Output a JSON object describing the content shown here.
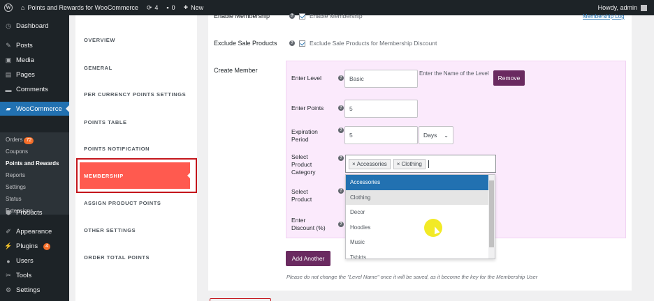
{
  "admin_bar": {
    "site_name": "Points and Rewards for WooCommerce",
    "updates_count": "4",
    "comments_count": "0",
    "new_label": "New",
    "greeting": "Howdy, admin"
  },
  "sidebar": {
    "items": [
      {
        "label": "Dashboard",
        "icon": "dashboard-icon"
      },
      {
        "label": "Posts",
        "icon": "pin-icon"
      },
      {
        "label": "Media",
        "icon": "media-icon"
      },
      {
        "label": "Pages",
        "icon": "pages-icon"
      },
      {
        "label": "Comments",
        "icon": "comment-icon"
      },
      {
        "label": "WooCommerce",
        "icon": "woo-icon"
      },
      {
        "label": "Products",
        "icon": "products-icon"
      },
      {
        "label": "Appearance",
        "icon": "brush-icon"
      },
      {
        "label": "Plugins",
        "icon": "plugin-icon",
        "badge": "4"
      },
      {
        "label": "Users",
        "icon": "user-icon"
      },
      {
        "label": "Tools",
        "icon": "wrench-icon"
      },
      {
        "label": "Settings",
        "icon": "settings-icon"
      }
    ],
    "submenu": [
      {
        "label": "Orders",
        "badge": "72"
      },
      {
        "label": "Coupons"
      },
      {
        "label": "Points and Rewards"
      },
      {
        "label": "Reports"
      },
      {
        "label": "Settings"
      },
      {
        "label": "Status"
      },
      {
        "label": "Extensions"
      }
    ]
  },
  "settings_nav": {
    "items": [
      "OVERVIEW",
      "GENERAL",
      "PER CURRENCY POINTS SETTINGS",
      "POINTS TABLE",
      "POINTS NOTIFICATION",
      "MEMBERSHIP",
      "ASSIGN PRODUCT POINTS",
      "OTHER SETTINGS",
      "ORDER TOTAL POINTS"
    ],
    "active": "MEMBERSHIP"
  },
  "form": {
    "enable_membership": {
      "label": "Enable Membership",
      "checkbox_label": "Enable Membership",
      "checked": true
    },
    "membership_log_link": "Membership Log",
    "exclude_sale": {
      "label": "Exclude Sale Products",
      "checkbox_label": "Exclude Sale Products for Membership Discount",
      "checked": true
    },
    "create_member_label": "Create Member",
    "enter_level": {
      "label": "Enter Level",
      "value": "Basic",
      "hint": "Enter the Name of the Level"
    },
    "remove_button": "Remove",
    "enter_points": {
      "label": "Enter Points",
      "value": "5"
    },
    "expiration": {
      "label_line1": "Expiration",
      "label_line2": "Period",
      "value": "5",
      "unit": "Days"
    },
    "category": {
      "label_line1": "Select",
      "label_line2": "Product",
      "label_line3": "Category",
      "tags": [
        "Accessories",
        "Clothing"
      ]
    },
    "select_product": {
      "label_line1": "Select",
      "label_line2": "Product"
    },
    "discount": {
      "label_line1": "Enter",
      "label_line2": "Discount (%)"
    },
    "dropdown_options": [
      "Accessories",
      "Clothing",
      "Decor",
      "Hoodies",
      "Music",
      "Tshirts"
    ],
    "dropdown_highlighted": "Accessories",
    "add_another_button": "Add Another",
    "note": "Please do not change the \"Level Name\" once it will be saved, as it become the key for the Membership User"
  }
}
